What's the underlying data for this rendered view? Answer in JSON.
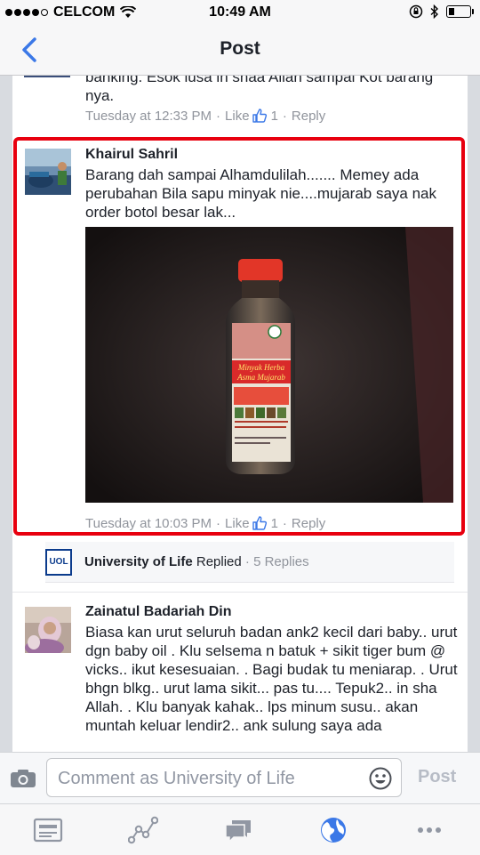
{
  "status_bar": {
    "carrier": "CELCOM",
    "time": "10:49 AM",
    "signal_bars": 4,
    "battery_level": 0.2
  },
  "nav": {
    "title": "Post",
    "back_icon": "chevron-left-icon"
  },
  "previous_comment": {
    "text": "banking. Esok lusa in shaa Allah sampai Kot barang nya.",
    "timestamp": "Tuesday at 12:33 PM",
    "like_label": "Like",
    "like_count": "1",
    "reply_label": "Reply"
  },
  "highlighted_comment": {
    "author": "Khairul Sahril",
    "text": "Barang dah sampai Alhamdulilah....... Memey ada perubahan Bila sapu minyak nie....mujarab saya nak order botol besar lak...",
    "photo": {
      "brand": "Minyak Herba Asma Mujarab",
      "subtitle": "MUJARAB JUGA UNTUK:",
      "uses": "Batuk dan Lelah, Asma, Selsema, Kembung Perut, Sakit Perut, Terkena Api, Digigit Binatang Berbisa, Sakit Gigi, Tegang dan Lain-Lain Penyakit",
      "contact": "019-9496133"
    },
    "timestamp": "Tuesday at 10:03 PM",
    "like_label": "Like",
    "like_count": "1",
    "reply_label": "Reply"
  },
  "replied_row": {
    "page_name": "University of Life",
    "action": "Replied",
    "count": "5 Replies",
    "logo_text": "UOL"
  },
  "next_comment": {
    "author": "Zainatul Badariah Din",
    "text": "Biasa kan urut  seluruh badan ank2 kecil dari baby.. urut dgn baby oil . Klu selsema n batuk + sikit tiger bum @ vicks.. ikut kesesuaian. . Bagi budak tu meniarap. . Urut bhgn blkg.. urut lama sikit... pas tu.... Tepuk2.. in sha Allah. . Klu banyak kahak.. lps minum susu.. akan muntah keluar lendir2.. ank sulung saya ada"
  },
  "composer": {
    "placeholder": "Comment as University of Life",
    "post_label": "Post"
  },
  "tab_bar": {
    "items": [
      "news-feed-icon",
      "activity-chart-icon",
      "messages-icon",
      "globe-notifications-icon",
      "more-icon"
    ],
    "active": "globe-notifications-icon"
  },
  "colors": {
    "accent": "#3b78e7",
    "highlight_border": "#e8000f",
    "meta_gray": "#90949c"
  }
}
